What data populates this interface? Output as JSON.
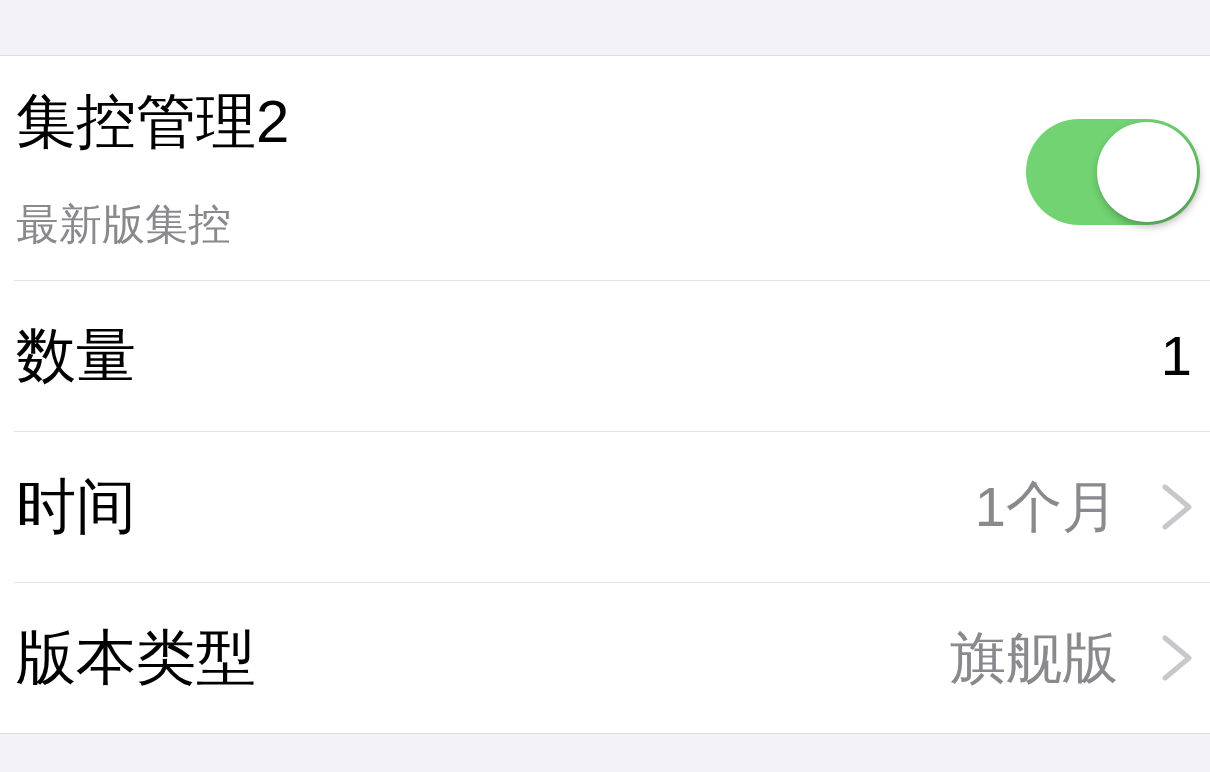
{
  "rows": [
    {
      "kind": "toggle",
      "title": "集控管理2",
      "subtitle": "最新版集控",
      "on": true
    },
    {
      "kind": "value",
      "title": "数量",
      "value": "1"
    },
    {
      "kind": "disclosure",
      "title": "时间",
      "value": "1个月"
    },
    {
      "kind": "disclosure",
      "title": "版本类型",
      "value": "旗舰版"
    }
  ]
}
